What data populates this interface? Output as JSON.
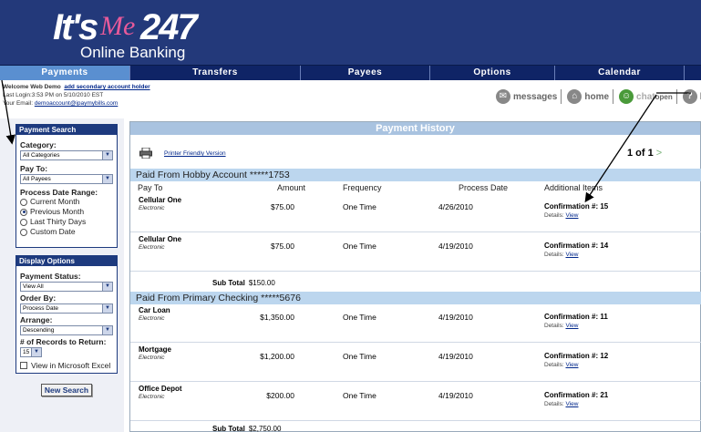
{
  "logo": {
    "its": "It's",
    "me": "Me",
    "num": "247",
    "sub": "Online Banking"
  },
  "nav": [
    {
      "label": "Payments",
      "active": true
    },
    {
      "label": "Transfers",
      "active": false
    },
    {
      "label": "Payees",
      "active": false
    },
    {
      "label": "Options",
      "active": false
    },
    {
      "label": "Calendar",
      "active": false
    }
  ],
  "welcome": {
    "prefix": "Welcome Web Demo",
    "add_link": "add secondary account holder",
    "last_login": "Last Login:3:53 PM on 5/10/2010 EST",
    "email_label": "Your Email:",
    "email": "demoaccount@ipaymybills.com"
  },
  "quicklinks": {
    "messages": "messages",
    "home": "home",
    "chat": "chat",
    "chat_status": "open",
    "cut": "he"
  },
  "payment_search": {
    "title": "Payment Search",
    "category_label": "Category:",
    "category_value": "All Categories",
    "payto_label": "Pay To:",
    "payto_value": "All Payees",
    "range_label": "Process Date Range:",
    "ranges": [
      "Current Month",
      "Previous Month",
      "Last Thirty Days",
      "Custom Date"
    ],
    "selected_range": 1
  },
  "display_options": {
    "title": "Display Options",
    "status_label": "Payment Status:",
    "status_value": "View All",
    "order_label": "Order By:",
    "order_value": "Process Date",
    "arrange_label": "Arrange:",
    "arrange_value": "Descending",
    "records_label": "# of Records to Return:",
    "records_value": "15",
    "excel_label": "View in Microsoft Excel"
  },
  "new_search": "New Search",
  "history": {
    "title": "Payment History",
    "print_link": "Printer Friendly Version",
    "paging": "1 of 1",
    "paging_next": ">",
    "columns": {
      "payto": "Pay To",
      "amount": "Amount",
      "frequency": "Frequency",
      "date": "Process Date",
      "items": "Additional Items"
    },
    "groups": [
      {
        "title": "Paid From Hobby Account *****1753",
        "rows": [
          {
            "payee": "Cellular One",
            "type": "Electronic",
            "amount": "$75.00",
            "frequency": "One Time",
            "date": "4/26/2010",
            "conf": "Confirmation #: 15",
            "details_label": "Details:",
            "view": "View"
          },
          {
            "payee": "Cellular One",
            "type": "Electronic",
            "amount": "$75.00",
            "frequency": "One Time",
            "date": "4/19/2010",
            "conf": "Confirmation #: 14",
            "details_label": "Details:",
            "view": "View"
          }
        ],
        "subtotal_label": "Sub Total",
        "subtotal": "$150.00"
      },
      {
        "title": "Paid From Primary Checking *****5676",
        "rows": [
          {
            "payee": "Car Loan",
            "type": "Electronic",
            "amount": "$1,350.00",
            "frequency": "One Time",
            "date": "4/19/2010",
            "conf": "Confirmation #: 11",
            "details_label": "Details:",
            "view": "View"
          },
          {
            "payee": "Mortgage",
            "type": "Electronic",
            "amount": "$1,200.00",
            "frequency": "One Time",
            "date": "4/19/2010",
            "conf": "Confirmation #: 12",
            "details_label": "Details:",
            "view": "View"
          },
          {
            "payee": "Office Depot",
            "type": "Electronic",
            "amount": "$200.00",
            "frequency": "One Time",
            "date": "4/19/2010",
            "conf": "Confirmation #: 21",
            "details_label": "Details:",
            "view": "View"
          }
        ],
        "subtotal_label": "Sub Total",
        "subtotal": "$2,750.00"
      }
    ]
  }
}
